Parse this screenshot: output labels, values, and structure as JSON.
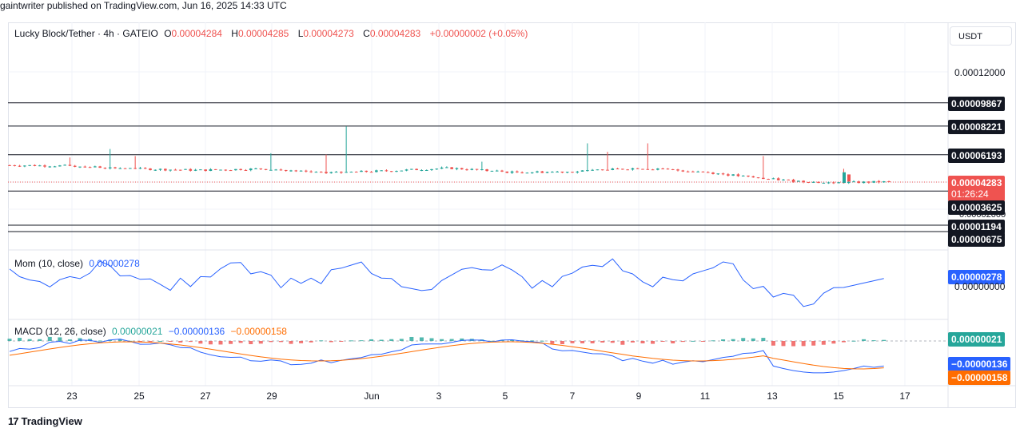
{
  "publisher": "gaintwriter published on TradingView.com, Jun 16, 2025 14:33 UTC",
  "currency": "USDT",
  "branding": "TradingView",
  "header": {
    "symbol": "Lucky Block/Tether · 4h · GATEIO",
    "o_label": "O",
    "o_value": "0.00004284",
    "h_label": "H",
    "h_value": "0.00004285",
    "l_label": "L",
    "l_value": "0.00004273",
    "c_label": "C",
    "c_value": "0.00004283",
    "change": "+0.00000002 (+0.05%)"
  },
  "price_axis": {
    "plain_labels": [
      "0.00012000",
      "0.00000000"
    ],
    "levels": [
      {
        "label": "0.00009867",
        "value": 9.867e-05
      },
      {
        "label": "0.00008221",
        "value": 8.221e-05
      },
      {
        "label": "0.00006193",
        "value": 6.193e-05
      },
      {
        "label": "0.00003625",
        "value": 3.625e-05
      },
      {
        "label": "0.00001194",
        "value": 1.194e-05
      },
      {
        "label": "0.00000675",
        "value": 6.75e-06
      }
    ],
    "last_price": "0.00004283",
    "countdown": "01:26:24",
    "partially_hidden_label": "0.00002000"
  },
  "momentum": {
    "legend": "Mom (10, close)",
    "value": "0.00000278",
    "axis_label": "0.00000278",
    "color": "#2962ff"
  },
  "macd": {
    "legend": "MACD (12, 26, close)",
    "hist": "0.00000021",
    "macd": "−0.00000136",
    "signal": "−0.00000158",
    "hist_label": "0.00000021",
    "macd_label": "−0.00000136",
    "signal_label": "−0.00000158",
    "colors": {
      "macd": "#2962ff",
      "signal": "#ff6d00",
      "hist_up": "#26a69a",
      "hist_down": "#ef5350",
      "hist_up_light": "#b2dfdb",
      "hist_down_light": "#ffcdd2"
    }
  },
  "x_axis": {
    "ticks": [
      "23",
      "25",
      "27",
      "29",
      "Jun",
      "3",
      "5",
      "7",
      "9",
      "11",
      "13",
      "15",
      "17"
    ]
  },
  "chart_data": {
    "type": "candlestick",
    "title": "Lucky Block/Tether · 4h · GATEIO",
    "ylabel": "USDT",
    "ylim": [
      0,
      0.00013
    ],
    "up_color": "#26a69a",
    "down_color": "#ef5350",
    "horizontal_levels": [
      9.867e-05,
      8.221e-05,
      6.193e-05,
      3.625e-05,
      1.194e-05,
      6.75e-06
    ],
    "approx_close_path": [
      {
        "x": "May 21",
        "y": 5.45e-05
      },
      {
        "x": "May 23",
        "y": 5.4e-05
      },
      {
        "x": "May 25",
        "y": 5.2e-05
      },
      {
        "x": "May 27",
        "y": 5.1e-05
      },
      {
        "x": "May 29",
        "y": 5.2e-05
      },
      {
        "x": "May 31",
        "y": 4.9e-05
      },
      {
        "x": "Jun 2",
        "y": 5.05e-05
      },
      {
        "x": "Jun 4",
        "y": 5.25e-05
      },
      {
        "x": "Jun 6",
        "y": 4.95e-05
      },
      {
        "x": "Jun 8",
        "y": 5e-05
      },
      {
        "x": "Jun 10",
        "y": 5.25e-05
      },
      {
        "x": "Jun 12",
        "y": 5e-05
      },
      {
        "x": "Jun 14",
        "y": 4.5e-05
      },
      {
        "x": "Jun 15",
        "y": 4.2e-05
      },
      {
        "x": "Jun 16",
        "y": 4.283e-05
      }
    ],
    "wicks": [
      {
        "x": "May 22",
        "high": 6e-05
      },
      {
        "x": "May 24",
        "high": 6.6e-05
      },
      {
        "x": "May 29",
        "high": 6.3e-05
      },
      {
        "x": "May 31",
        "high": 6.2e-05
      },
      {
        "x": "May 31",
        "high": 8.2e-05
      },
      {
        "x": "Jun 4",
        "high": 7e-05
      },
      {
        "x": "Jun 5",
        "high": 6.4e-05
      },
      {
        "x": "Jun 6",
        "high": 7e-05
      },
      {
        "x": "Jun 9",
        "high": 6.1e-05
      },
      {
        "x": "Jun 15",
        "high": 5.2e-05
      }
    ]
  }
}
